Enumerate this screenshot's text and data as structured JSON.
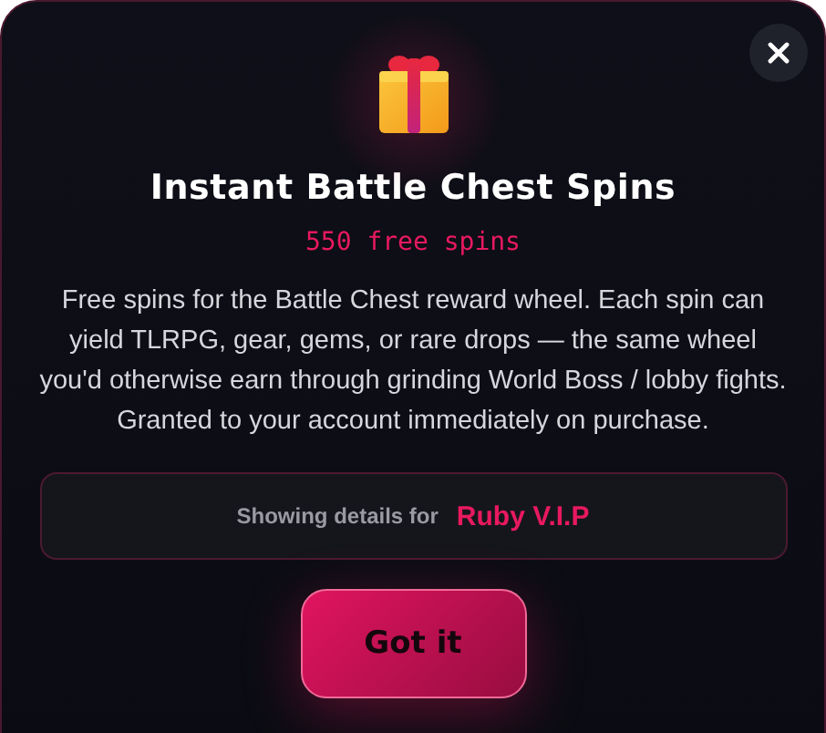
{
  "dialog": {
    "title": "Instant Battle Chest Spins",
    "subtitle": "550 free spins",
    "description": "Free spins for the Battle Chest reward wheel. Each spin can yield TLRPG, gear, gems, or rare drops — the same wheel you'd otherwise earn through grinding World Boss / lobby fights. Granted to your account immediately on purchase.",
    "details": {
      "label": "Showing details for",
      "value": "Ruby V.I.P"
    },
    "button": "Got it"
  }
}
